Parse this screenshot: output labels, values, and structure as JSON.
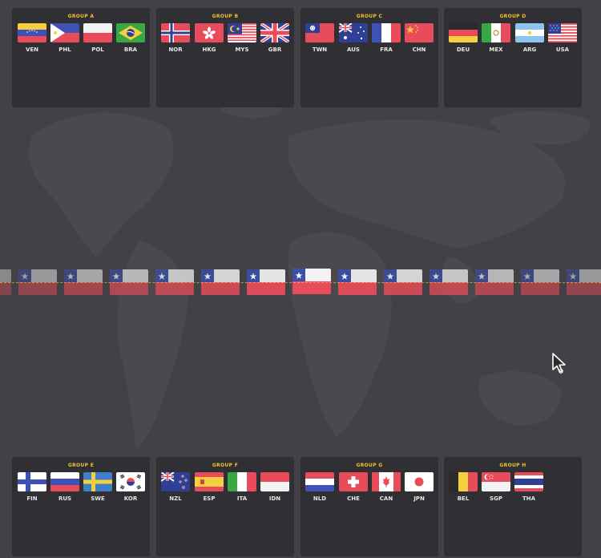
{
  "groups": [
    {
      "title": "GROUP A",
      "teams": [
        {
          "code": "VEN",
          "flag": "venezuela-flag"
        },
        {
          "code": "PHL",
          "flag": "philippines-flag"
        },
        {
          "code": "POL",
          "flag": "poland-flag"
        },
        {
          "code": "BRA",
          "flag": "brazil-flag"
        }
      ]
    },
    {
      "title": "GROUP B",
      "teams": [
        {
          "code": "NOR",
          "flag": "norway-flag"
        },
        {
          "code": "HKG",
          "flag": "hong-kong-flag"
        },
        {
          "code": "MYS",
          "flag": "malaysia-flag"
        },
        {
          "code": "GBR",
          "flag": "united-kingdom-flag"
        }
      ]
    },
    {
      "title": "GROUP C",
      "teams": [
        {
          "code": "TWN",
          "flag": "taiwan-flag"
        },
        {
          "code": "AUS",
          "flag": "australia-flag"
        },
        {
          "code": "FRA",
          "flag": "france-flag"
        },
        {
          "code": "CHN",
          "flag": "china-flag"
        }
      ]
    },
    {
      "title": "GROUP D",
      "teams": [
        {
          "code": "DEU",
          "flag": "germany-flag"
        },
        {
          "code": "MEX",
          "flag": "mexico-flag"
        },
        {
          "code": "ARG",
          "flag": "argentina-flag"
        },
        {
          "code": "USA",
          "flag": "united-states-flag"
        }
      ]
    },
    {
      "title": "GROUP E",
      "teams": [
        {
          "code": "FIN",
          "flag": "finland-flag"
        },
        {
          "code": "RUS",
          "flag": "russia-flag"
        },
        {
          "code": "SWE",
          "flag": "sweden-flag"
        },
        {
          "code": "KOR",
          "flag": "south-korea-flag"
        }
      ]
    },
    {
      "title": "GROUP F",
      "teams": [
        {
          "code": "NZL",
          "flag": "new-zealand-flag"
        },
        {
          "code": "ESP",
          "flag": "spain-flag"
        },
        {
          "code": "ITA",
          "flag": "italy-flag"
        },
        {
          "code": "IDN",
          "flag": "indonesia-flag"
        }
      ]
    },
    {
      "title": "GROUP G",
      "teams": [
        {
          "code": "NLD",
          "flag": "netherlands-flag"
        },
        {
          "code": "CHE",
          "flag": "switzerland-flag"
        },
        {
          "code": "CAN",
          "flag": "canada-flag"
        },
        {
          "code": "JPN",
          "flag": "japan-flag"
        }
      ]
    },
    {
      "title": "GROUP H",
      "teams": [
        {
          "code": "BEL",
          "flag": "belgium-flag"
        },
        {
          "code": "SGP",
          "flag": "singapore-flag"
        },
        {
          "code": "THA",
          "flag": "thailand-flag"
        }
      ]
    }
  ],
  "draw_reel": {
    "flag": "chile-flag",
    "visible_count": 14
  },
  "colors": {
    "background": "#434145",
    "card": "#302f33",
    "group_title": "#f1c232",
    "team_code": "#e7e7e7",
    "reel_guide": "#ffdf50"
  },
  "cursor_icon": "arrow-pointer-icon"
}
